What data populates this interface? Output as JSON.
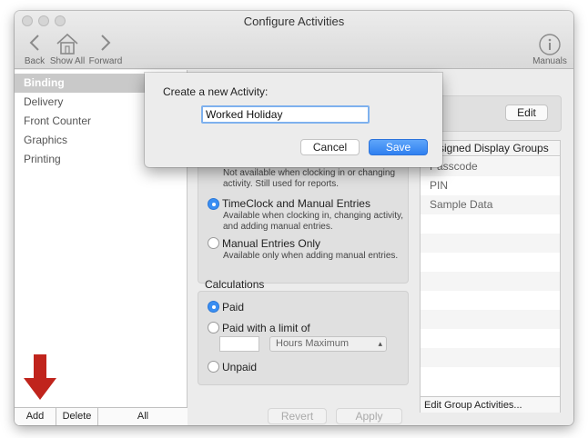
{
  "window": {
    "title": "Configure Activities"
  },
  "toolbar": {
    "back_label": "Back",
    "showall_label": "Show All",
    "forward_label": "Forward",
    "manuals_label": "Manuals"
  },
  "sidebar": {
    "items": [
      {
        "label": "Binding"
      },
      {
        "label": "Delivery"
      },
      {
        "label": "Front Counter"
      },
      {
        "label": "Graphics"
      },
      {
        "label": "Printing"
      }
    ],
    "add_label": "Add",
    "delete_label": "Delete",
    "all_label": "All"
  },
  "dialog": {
    "prompt": "Create a new Activity:",
    "input_value": "Worked Holiday",
    "cancel_label": "Cancel",
    "save_label": "Save"
  },
  "main": {
    "edit_label": "Edit",
    "availability": {
      "opt1_desc": "Not available when clocking in or changing activity. Still used for reports.",
      "opt2_label": "TimeClock and Manual Entries",
      "opt2_desc": "Available when clocking in, changing activity, and adding manual entries.",
      "opt3_label": "Manual Entries Only",
      "opt3_desc": "Available only when adding manual entries."
    },
    "calculations": {
      "title": "Calculations",
      "paid_label": "Paid",
      "paid_limit_label": "Paid with a limit of",
      "hours_select": "Hours Maximum",
      "unpaid_label": "Unpaid"
    },
    "revert_label": "Revert",
    "apply_label": "Apply"
  },
  "groups": {
    "header": "Assigned Display Groups",
    "rows": [
      "Passcode",
      "PIN",
      "Sample Data"
    ],
    "footer_label": "Edit Group Activities..."
  },
  "colors": {
    "accent": "#3a8ef2",
    "arrow": "#c0241c"
  }
}
